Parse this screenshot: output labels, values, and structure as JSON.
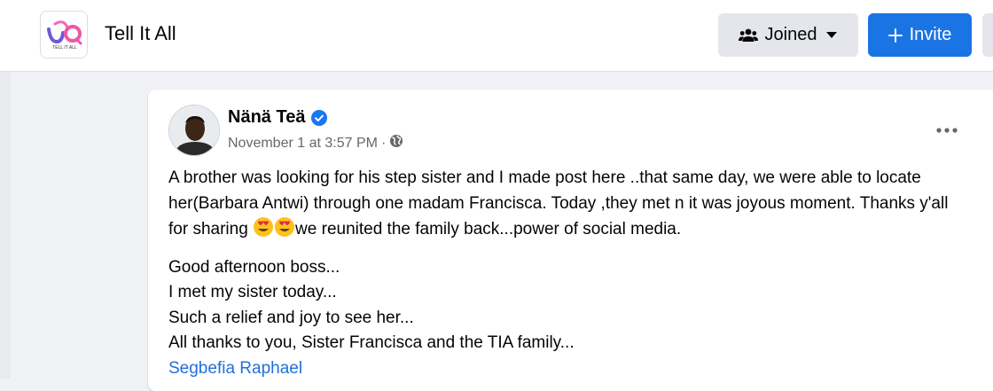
{
  "header": {
    "group_name": "Tell It All",
    "logo_text": "TELL IT ALL",
    "joined_label": "Joined",
    "invite_label": "Invite"
  },
  "post": {
    "author": "Nänä Teä",
    "timestamp": "November 1 at 3:57 PM",
    "separator": "·",
    "text1_a": "A brother was looking for his step sister and I made post here ..that same day, we were able to locate her(Barbara Antwi) through one madam Francisca. Today ,they met n it was joyous moment. Thanks y'all for sharing ",
    "text1_b": "we reunited the family back...power of social media.",
    "lines": [
      "Good afternoon boss...",
      "I met my sister today...",
      "Such a relief and joy to see her...",
      "All thanks to you, Sister Francisca and the TIA family..."
    ],
    "mention": "Segbefia Raphael"
  },
  "icons": {
    "group_logo": "tia-logo",
    "joined": "people-icon",
    "caret": "caret-down-icon",
    "invite": "plus-icon",
    "verified": "verified-badge-icon",
    "privacy": "globe-icon",
    "menu": "more-dots-icon",
    "emoji": "heart-eyes-emoji"
  },
  "colors": {
    "brand_blue": "#1b74e4",
    "link_blue": "#216fdb",
    "secondary_text": "#65676b",
    "button_gray": "#e4e6eb"
  }
}
